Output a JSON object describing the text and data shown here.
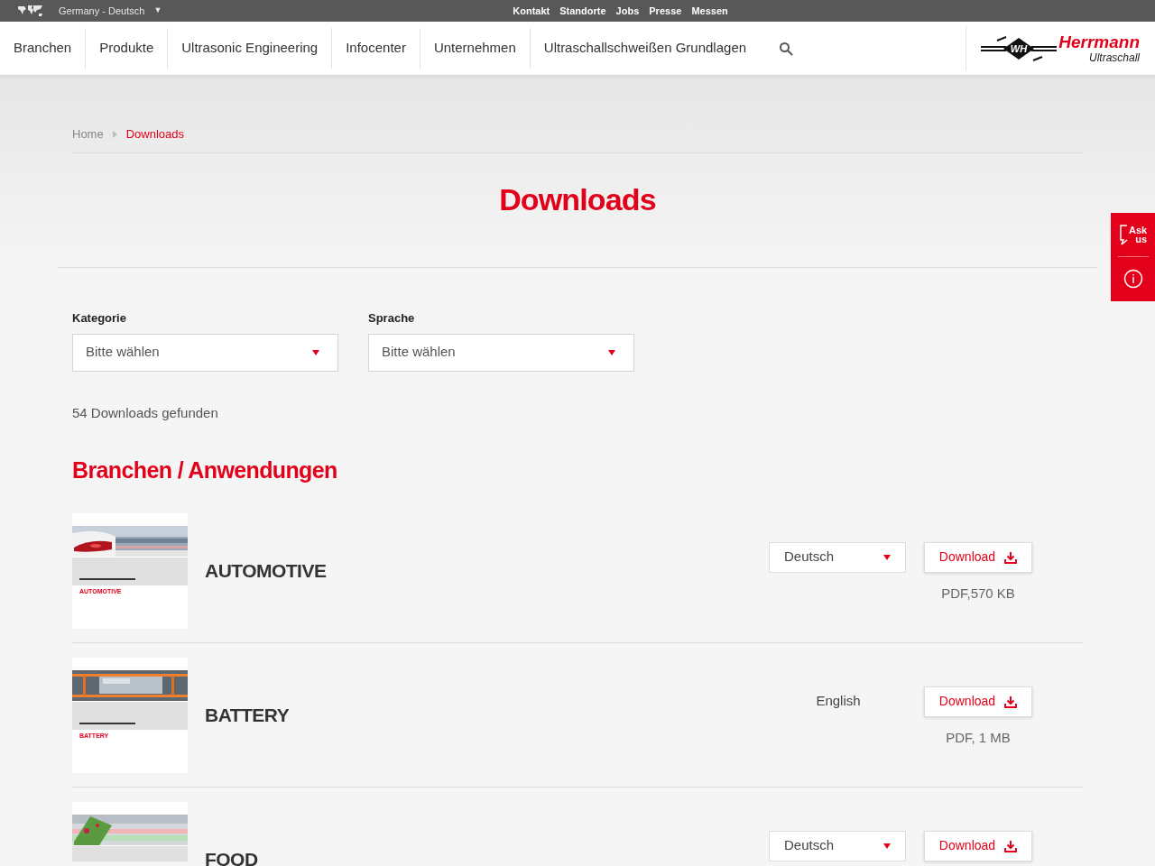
{
  "top_bar": {
    "region": "Germany - Deutsch",
    "caret": "▼",
    "links": [
      "Kontakt",
      "Standorte",
      "Jobs",
      "Presse",
      "Messen"
    ]
  },
  "nav": {
    "items": [
      "Branchen",
      "Produkte",
      "Ultrasonic Engineering",
      "Infocenter",
      "Unternehmen",
      "Ultraschallschweißen Grundlagen"
    ]
  },
  "logo": {
    "mark": "WH",
    "name": "Herrmann",
    "tagline": "Ultraschall"
  },
  "breadcrumb": [
    {
      "label": "Home",
      "selected": false
    },
    {
      "label": "Downloads",
      "selected": true
    }
  ],
  "title": "Downloads",
  "filters": [
    {
      "label": "Kategorie",
      "placeholder": "Bitte wählen"
    },
    {
      "label": "Sprache",
      "placeholder": "Bitte wählen"
    }
  ],
  "result_count": "54 Downloads gefunden",
  "section_title": "Branchen / Anwendungen",
  "downloads": [
    {
      "title": "AUTOMOTIVE",
      "cover": {
        "label": "AUTOMOTIVE"
      },
      "language": {
        "kind": "select",
        "value": "Deutsch"
      },
      "button": "Download",
      "info": "PDF,570 KB"
    },
    {
      "title": "BATTERY",
      "cover": {
        "label": "BATTERY"
      },
      "language": {
        "kind": "text",
        "value": "English"
      },
      "button": "Download",
      "info": "PDF, 1 MB"
    },
    {
      "title": "FOOD",
      "language": {
        "kind": "select",
        "value": "Deutsch"
      },
      "button": "Download"
    }
  ],
  "side_widget": {
    "ask": "Ask us"
  }
}
